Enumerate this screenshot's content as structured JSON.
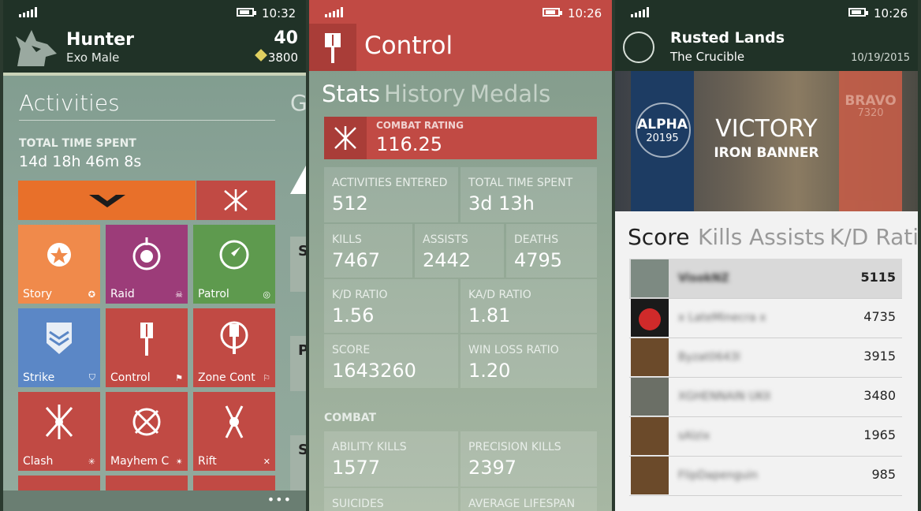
{
  "status": {
    "time_1": "10:32",
    "time_2": "10:26",
    "time_3": "10:26"
  },
  "character": {
    "class": "Hunter",
    "race": "Exo Male",
    "level": "40",
    "glimmer": "3800"
  },
  "activities": {
    "pivot": "Activities",
    "pivot_next": "G",
    "time_label": "TOTAL TIME SPENT",
    "time_value": "14d 18h 46m 8s",
    "tiles": [
      {
        "label": "Story",
        "color": "#f08a4b"
      },
      {
        "label": "Raid",
        "color": "#9c3c79"
      },
      {
        "label": "Patrol",
        "color": "#5e9a4e"
      },
      {
        "label": "Strike",
        "color": "#5b87c6"
      },
      {
        "label": "Control",
        "color": "#c14a44"
      },
      {
        "label": "Zone Control",
        "color": "#c14a44"
      },
      {
        "label": "Clash",
        "color": "#c14a44"
      },
      {
        "label": "Mayhem Clash",
        "color": "#c14a44"
      },
      {
        "label": "Rift",
        "color": "#c14a44"
      }
    ],
    "edge_letters": [
      "S",
      "P",
      "S"
    ],
    "more": "•••"
  },
  "control": {
    "title": "Control",
    "tabs": [
      "Stats",
      "History",
      "Medals"
    ],
    "combat_rating_label": "COMBAT RATING",
    "combat_rating": "116.25",
    "stats": [
      {
        "label": "ACTIVITIES ENTERED",
        "value": "512"
      },
      {
        "label": "TOTAL TIME SPENT",
        "value": "3d 13h"
      },
      {
        "label": "KILLS",
        "value": "7467"
      },
      {
        "label": "ASSISTS",
        "value": "2442"
      },
      {
        "label": "DEATHS",
        "value": "4795"
      },
      {
        "label": "K/D RATIO",
        "value": "1.56"
      },
      {
        "label": "KA/D RATIO",
        "value": "1.81"
      },
      {
        "label": "SCORE",
        "value": "1643260"
      },
      {
        "label": "WIN LOSS RATIO",
        "value": "1.20"
      }
    ],
    "section": "COMBAT",
    "combat": [
      {
        "label": "ABILITY KILLS",
        "value": "1577"
      },
      {
        "label": "PRECISION KILLS",
        "value": "2397"
      },
      {
        "label": "SUICIDES",
        "value": ""
      },
      {
        "label": "AVERAGE LIFESPAN",
        "value": ""
      }
    ]
  },
  "match": {
    "map": "Rusted Lands",
    "mode": "The Crucible",
    "date": "10/19/2015",
    "alpha_name": "ALPHA",
    "alpha_score": "20195",
    "bravo_name": "BRAVO",
    "bravo_score": "7320",
    "result": "VICTORY",
    "event": "IRON BANNER",
    "tabs": [
      "Score",
      "Kills",
      "Assists",
      "K/D Ratio"
    ],
    "players": [
      {
        "name": "VisokNZ",
        "score": "5115"
      },
      {
        "name": "x LateMinecra x",
        "score": "4735"
      },
      {
        "name": "Byzat0643l",
        "score": "3915"
      },
      {
        "name": "XGHENNAIN UKII",
        "score": "3480"
      },
      {
        "name": "sAlzix",
        "score": "1965"
      },
      {
        "name": "FlipDapenguin",
        "score": "985"
      }
    ]
  }
}
